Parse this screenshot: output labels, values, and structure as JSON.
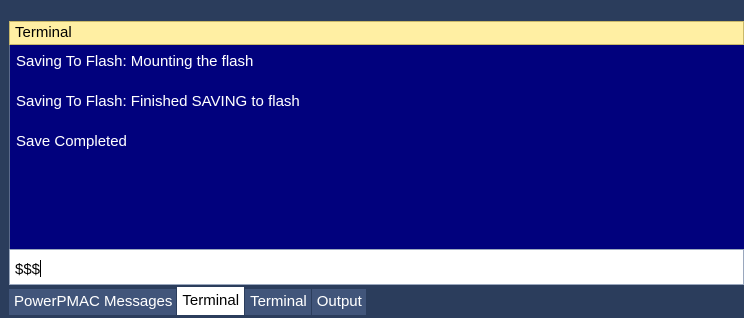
{
  "panel": {
    "title": "Terminal"
  },
  "terminal": {
    "lines": [
      "Saving To Flash: Mounting the flash",
      "Saving To Flash: Finished SAVING to flash",
      "Save Completed"
    ]
  },
  "command": {
    "value": "$$$"
  },
  "tabs": [
    {
      "label": "PowerPMAC Messages",
      "active": false
    },
    {
      "label": "Terminal",
      "active": true
    },
    {
      "label": "Terminal",
      "active": false
    },
    {
      "label": "Output",
      "active": false
    }
  ],
  "colors": {
    "title_bg": "#ffefa3",
    "terminal_bg": "#01017d",
    "frame_bg": "#2b3d5c"
  }
}
